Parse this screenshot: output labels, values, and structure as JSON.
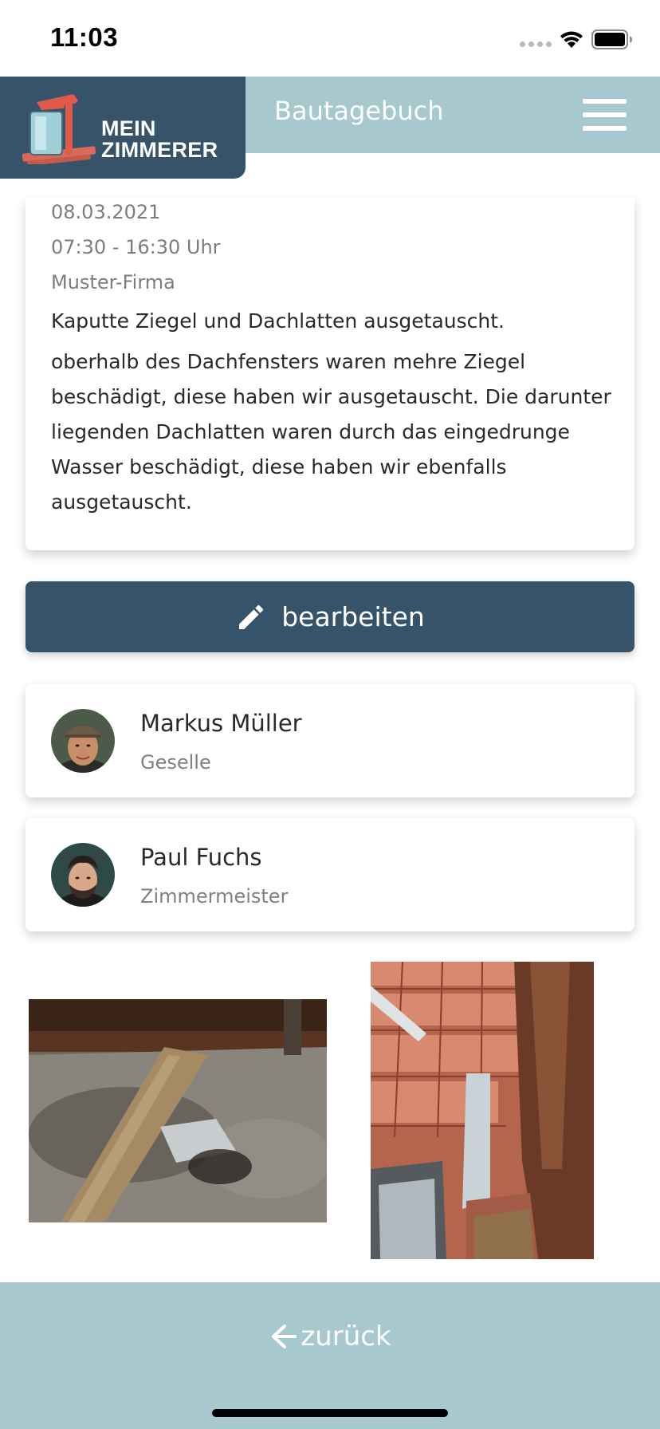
{
  "status_bar": {
    "time": "11:03"
  },
  "header": {
    "logo_line1": "MEIN",
    "logo_line2": "ZIMMERER",
    "title": "Bautagebuch",
    "menu_icon": "hamburger-menu-icon"
  },
  "entry": {
    "date": "08.03.2021",
    "time_range": "07:30 - 16:30 Uhr",
    "company": "Muster-Firma",
    "title": "Kaputte Ziegel und Dachlatten ausgetauscht.",
    "description": "oberhalb des Dachfensters waren mehre Ziegel beschädigt, diese haben wir ausgetauscht. Die darunter liegenden Dachlatten waren durch das eingedrunge Wasser beschädigt, diese haben wir ebenfalls ausgetauscht."
  },
  "edit_button": {
    "label": "bearbeiten",
    "icon": "pencil-icon"
  },
  "people": [
    {
      "name": "Markus Müller",
      "role": "Geselle"
    },
    {
      "name": "Paul Fuchs",
      "role": "Zimmermeister"
    }
  ],
  "footer": {
    "back_label": "zurück",
    "icon": "arrow-left-icon"
  },
  "colors": {
    "primary_dark": "#37536a",
    "header_light": "#a7c8cf",
    "text_muted": "#7d7d7d"
  }
}
